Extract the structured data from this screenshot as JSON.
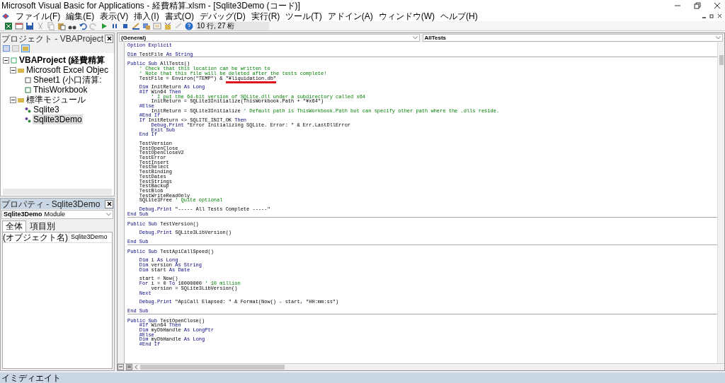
{
  "window": {
    "title": "Microsoft Visual Basic for Applications - 経費精算.xlsm - [Sqlite3Demo (コード)]"
  },
  "menu": [
    "ファイル(F)",
    "編集(E)",
    "表示(V)",
    "挿入(I)",
    "書式(O)",
    "デバッグ(D)",
    "実行(R)",
    "ツール(T)",
    "アドイン(A)",
    "ウィンドウ(W)",
    "ヘルプ(H)"
  ],
  "toolbar": {
    "position": "10 行, 27 桁"
  },
  "project": {
    "title": "プロジェクト - VBAProject",
    "tree": [
      {
        "label": "VBAProject (経費精算",
        "kind": "project",
        "expanded": true,
        "selected": false,
        "children": [
          {
            "label": "Microsoft Excel Objec",
            "kind": "folder",
            "expanded": true,
            "selected": false,
            "children": [
              {
                "label": "Sheet1 (小口清算:",
                "kind": "sheet",
                "selected": false
              },
              {
                "label": "ThisWorkbook",
                "kind": "workbook",
                "selected": false
              }
            ]
          },
          {
            "label": "標準モジュール",
            "kind": "folder",
            "expanded": true,
            "selected": false,
            "children": [
              {
                "label": "Sqlite3",
                "kind": "module",
                "selected": false
              },
              {
                "label": "Sqlite3Demo",
                "kind": "module",
                "selected": true
              }
            ]
          }
        ]
      }
    ]
  },
  "properties": {
    "title": "プロパティ - Sqlite3Demo",
    "object_name": "Sqlite3Demo",
    "object_type": "Module",
    "tabs": [
      {
        "label": "全体",
        "selected": true
      },
      {
        "label": "項目別",
        "selected": false
      }
    ],
    "rows": [
      {
        "name": "(オブジェクト名)",
        "value": "Sqlite3Demo"
      }
    ]
  },
  "code": {
    "object": "(General)",
    "procedure": "AllTests",
    "procedures": [
      [
        {
          "segments": [
            {
              "kind": "keyword",
              "text": "Option Explicit"
            }
          ]
        },
        {
          "space_before": true,
          "segments": [
            {
              "kind": "keyword",
              "text": "Dim"
            },
            {
              "kind": "text",
              "text": " TestFile "
            },
            {
              "kind": "keyword",
              "text": "As String"
            }
          ]
        }
      ],
      [
        {
          "space_before": true,
          "segments": [
            {
              "kind": "keyword",
              "text": "Public Sub"
            },
            {
              "kind": "text",
              "text": " AllTests()"
            }
          ]
        },
        {
          "segments": [
            {
              "kind": "comment",
              "text": "    ' Check that this location can be written to"
            }
          ]
        },
        {
          "segments": [
            {
              "kind": "comment",
              "text": "    ' Note that this file will be deleted after the tests complete!"
            }
          ]
        },
        {
          "segments": [
            {
              "kind": "text",
              "text": "    TestFile = Environ(\"TEMP\") & "
            },
            {
              "kind": "text",
              "text": "\"¥liquidation.db\"",
              "underlined": true
            }
          ]
        },
        {
          "space_before": true,
          "segments": [
            {
              "kind": "keyword",
              "text": "    Dim"
            },
            {
              "kind": "text",
              "text": " InitReturn "
            },
            {
              "kind": "keyword",
              "text": "As Long"
            }
          ]
        },
        {
          "segments": [
            {
              "kind": "keyword",
              "text": "    #If"
            },
            {
              "kind": "text",
              "text": " Win64 "
            },
            {
              "kind": "keyword",
              "text": "Then"
            }
          ]
        },
        {
          "segments": [
            {
              "kind": "comment",
              "text": "        ' I put the 64-bit version of SQLite.dll under a subdirectory called x64"
            }
          ]
        },
        {
          "segments": [
            {
              "kind": "text",
              "text": "        InitReturn = SQLite3Initialize(ThisWorkbook.Path + \"¥x64\")"
            }
          ]
        },
        {
          "segments": [
            {
              "kind": "keyword",
              "text": "    #Else"
            }
          ]
        },
        {
          "segments": [
            {
              "kind": "text",
              "text": "        InitReturn = SQLite3Initialize "
            },
            {
              "kind": "comment",
              "text": "' Default path is ThisWorkbook.Path but can specify other path where the .dlls reside."
            }
          ]
        },
        {
          "segments": [
            {
              "kind": "keyword",
              "text": "    #End If"
            }
          ]
        },
        {
          "segments": [
            {
              "kind": "keyword",
              "text": "    If"
            },
            {
              "kind": "text",
              "text": " InitReturn <> SQLITE_INIT_OK "
            },
            {
              "kind": "keyword",
              "text": "Then"
            }
          ]
        },
        {
          "segments": [
            {
              "kind": "keyword",
              "text": "        Debug.Print"
            },
            {
              "kind": "text",
              "text": " \"Error Initializing SQLite. Error: \" & Err.LastDllError"
            }
          ]
        },
        {
          "segments": [
            {
              "kind": "keyword",
              "text": "        Exit Sub"
            }
          ]
        },
        {
          "segments": [
            {
              "kind": "keyword",
              "text": "    End If"
            }
          ]
        },
        {
          "space_before": true,
          "segments": [
            {
              "kind": "text",
              "text": "    TestVersion"
            }
          ]
        },
        {
          "segments": [
            {
              "kind": "text",
              "text": "    TestOpenClose"
            }
          ]
        },
        {
          "segments": [
            {
              "kind": "text",
              "text": "    TestOpenCloseV2"
            }
          ]
        },
        {
          "segments": [
            {
              "kind": "text",
              "text": "    TestError"
            }
          ]
        },
        {
          "segments": [
            {
              "kind": "text",
              "text": "    TestInsert"
            }
          ]
        },
        {
          "segments": [
            {
              "kind": "text",
              "text": "    TestSelect"
            }
          ]
        },
        {
          "segments": [
            {
              "kind": "text",
              "text": "    TestBinding"
            }
          ]
        },
        {
          "segments": [
            {
              "kind": "text",
              "text": "    TestDates"
            }
          ]
        },
        {
          "segments": [
            {
              "kind": "text",
              "text": "    TestStrings"
            }
          ]
        },
        {
          "segments": [
            {
              "kind": "text",
              "text": "    TestBackup"
            }
          ]
        },
        {
          "segments": [
            {
              "kind": "text",
              "text": "    TestBlob"
            }
          ]
        },
        {
          "segments": [
            {
              "kind": "text",
              "text": "    TestWriteReadOnly"
            }
          ]
        },
        {
          "segments": [
            {
              "kind": "text",
              "text": "    SQLite3Free "
            },
            {
              "kind": "comment",
              "text": "' Quite optional"
            }
          ]
        },
        {
          "space_before": true,
          "segments": [
            {
              "kind": "keyword",
              "text": "    Debug.Print"
            },
            {
              "kind": "text",
              "text": " \"----- All Tests Complete -----\""
            }
          ]
        },
        {
          "segments": [
            {
              "kind": "keyword",
              "text": "End Sub"
            }
          ]
        }
      ],
      [
        {
          "space_before": true,
          "segments": [
            {
              "kind": "keyword",
              "text": "Public Sub"
            },
            {
              "kind": "text",
              "text": " TestVersion()"
            }
          ]
        },
        {
          "space_before": true,
          "segments": [
            {
              "kind": "keyword",
              "text": "    Debug.Print"
            },
            {
              "kind": "text",
              "text": " SQLite3LibVersion()"
            }
          ]
        },
        {
          "space_before": true,
          "segments": [
            {
              "kind": "keyword",
              "text": "End Sub"
            }
          ]
        }
      ],
      [
        {
          "space_before": true,
          "segments": [
            {
              "kind": "keyword",
              "text": "Public Sub"
            },
            {
              "kind": "text",
              "text": " TestApiCallSpeed()"
            }
          ]
        },
        {
          "space_before": true,
          "segments": [
            {
              "kind": "keyword",
              "text": "    Dim"
            },
            {
              "kind": "text",
              "text": " i "
            },
            {
              "kind": "keyword",
              "text": "As Long"
            }
          ]
        },
        {
          "segments": [
            {
              "kind": "keyword",
              "text": "    Dim"
            },
            {
              "kind": "text",
              "text": " version "
            },
            {
              "kind": "keyword",
              "text": "As String"
            }
          ]
        },
        {
          "segments": [
            {
              "kind": "keyword",
              "text": "    Dim"
            },
            {
              "kind": "text",
              "text": " start "
            },
            {
              "kind": "keyword",
              "text": "As Date"
            }
          ]
        },
        {
          "space_before": true,
          "segments": [
            {
              "kind": "text",
              "text": "    start = Now()"
            }
          ]
        },
        {
          "segments": [
            {
              "kind": "keyword",
              "text": "    For"
            },
            {
              "kind": "text",
              "text": " i = 0 "
            },
            {
              "kind": "keyword",
              "text": "To"
            },
            {
              "kind": "text",
              "text": " 10000000 "
            },
            {
              "kind": "comment",
              "text": "' 10 million"
            }
          ]
        },
        {
          "segments": [
            {
              "kind": "text",
              "text": "        version = SQLite3LibVersion()"
            }
          ]
        },
        {
          "segments": [
            {
              "kind": "keyword",
              "text": "    Next"
            }
          ]
        },
        {
          "space_before": true,
          "segments": [
            {
              "kind": "keyword",
              "text": "    Debug.Print"
            },
            {
              "kind": "text",
              "text": " \"ApiCall Elapsed: \" & Format(Now() - start, \"HH:mm:ss\")"
            }
          ]
        },
        {
          "space_before": true,
          "segments": [
            {
              "kind": "keyword",
              "text": "End Sub"
            }
          ]
        }
      ],
      [
        {
          "space_before": true,
          "segments": [
            {
              "kind": "keyword",
              "text": "Public Sub"
            },
            {
              "kind": "text",
              "text": " TestOpenClose()"
            }
          ]
        },
        {
          "segments": [
            {
              "kind": "keyword",
              "text": "    #If"
            },
            {
              "kind": "text",
              "text": " Win64 "
            },
            {
              "kind": "keyword",
              "text": "Then"
            }
          ]
        },
        {
          "segments": [
            {
              "kind": "keyword",
              "text": "    Dim"
            },
            {
              "kind": "text",
              "text": " myDbHandle "
            },
            {
              "kind": "keyword",
              "text": "As LongPtr"
            }
          ]
        },
        {
          "segments": [
            {
              "kind": "keyword",
              "text": "    #Else"
            }
          ]
        },
        {
          "segments": [
            {
              "kind": "keyword",
              "text": "    Dim"
            },
            {
              "kind": "text",
              "text": " myDbHandle "
            },
            {
              "kind": "keyword",
              "text": "As Long"
            }
          ]
        },
        {
          "segments": [
            {
              "kind": "keyword",
              "text": "    #End If"
            }
          ]
        }
      ]
    ]
  },
  "immediate": {
    "title": "イミディエイト"
  }
}
